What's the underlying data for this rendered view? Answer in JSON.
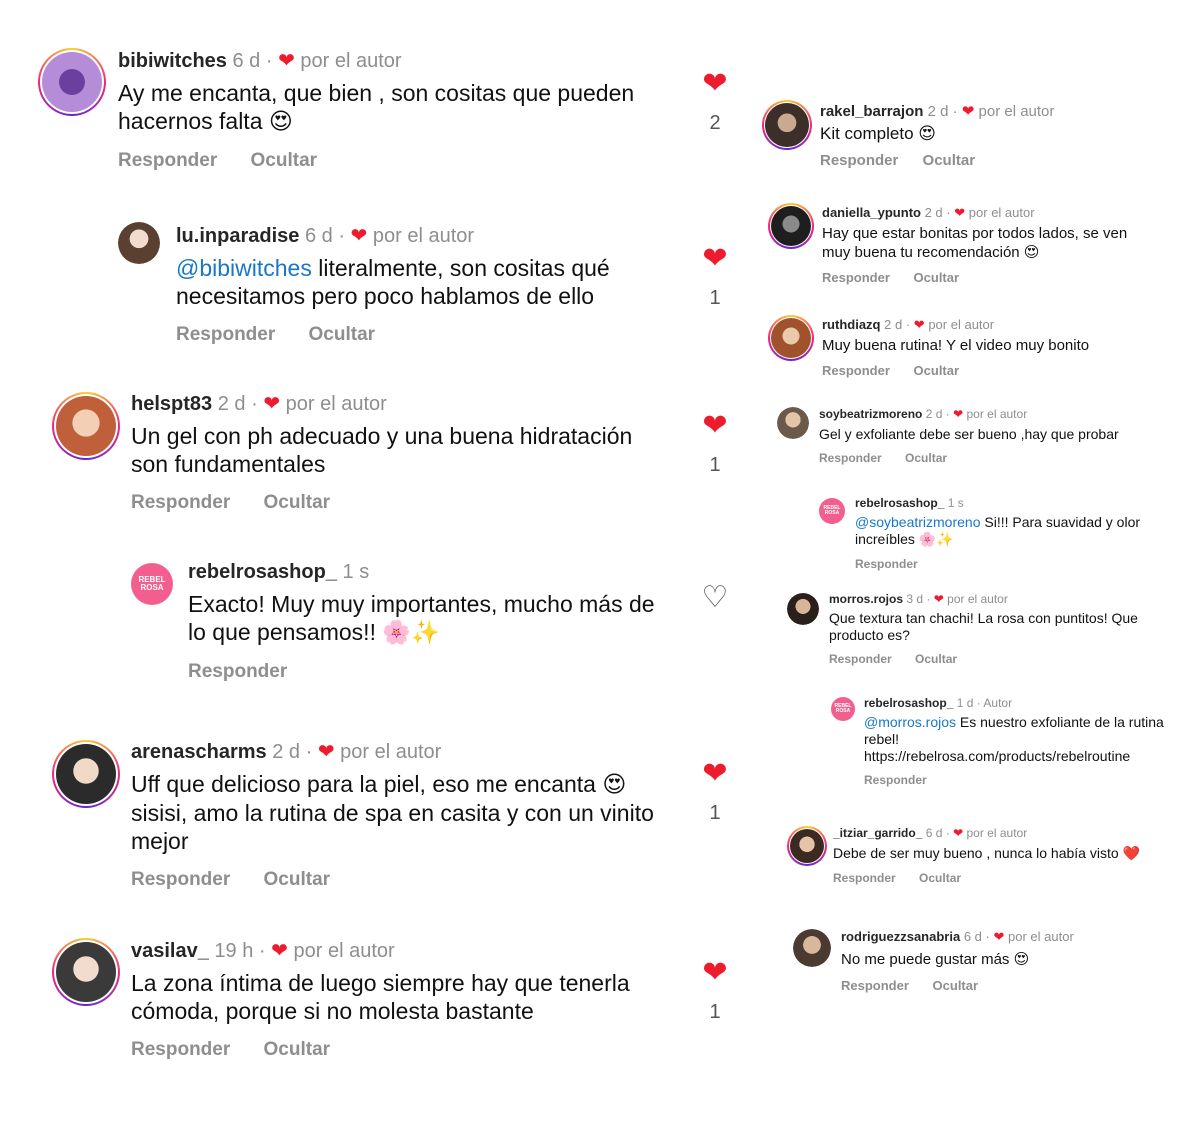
{
  "left_comments": [
    {
      "user": "bibiwitches",
      "time": "6 d",
      "by_author": "por el autor",
      "text": "Ay me encanta, que bien , son cositas que pueden hacernos falta",
      "emoji": "😍",
      "reply": "Responder",
      "hide": "Ocultar",
      "likes": "2"
    },
    {
      "user": "lu.inparadise",
      "time": "6 d",
      "by_author": "por el autor",
      "mention": "@bibiwitches",
      "text": " literalmente, son cositas qué necesitamos pero poco hablamos de ello",
      "reply": "Responder",
      "hide": "Ocultar",
      "likes": "1"
    },
    {
      "user": "helspt83",
      "time": "2 d",
      "by_author": "por el autor",
      "text": "Un gel con ph adecuado y una buena hidratación son fundamentales",
      "reply": "Responder",
      "hide": "Ocultar",
      "likes": "1"
    },
    {
      "user": "rebelrosashop_",
      "time": "1 s",
      "text": "Exacto! Muy muy importantes, mucho más de lo que pensamos!!",
      "emoji": "🌸✨",
      "reply": "Responder",
      "avatar_text": "REBEL ROSA"
    },
    {
      "user": "arenascharms",
      "time": "2 d",
      "by_author": "por el autor",
      "text": "Uff que delicioso para la piel, eso me encanta",
      "emoji": "😍",
      "text2": "sisisi, amo la rutina de spa en casita y con un vinito mejor",
      "reply": "Responder",
      "hide": "Ocultar",
      "likes": "1"
    },
    {
      "user": "vasilav_",
      "time": "19 h",
      "by_author": "por el autor",
      "text": "La zona íntima de luego siempre hay que tenerla cómoda, porque si no molesta bastante",
      "reply": "Responder",
      "hide": "Ocultar",
      "likes": "1"
    }
  ],
  "right_comments": [
    {
      "user": "rakel_barrajon",
      "time": "2 d",
      "by_author": "por el autor",
      "text": "Kit completo",
      "emoji": "😍",
      "reply": "Responder",
      "hide": "Ocultar"
    },
    {
      "user": "daniella_ypunto",
      "time": "2 d",
      "by_author": "por el autor",
      "text": "Hay que estar bonitas por todos lados, se ven muy buena tu recomendación",
      "emoji": "😍",
      "reply": "Responder",
      "hide": "Ocultar"
    },
    {
      "user": "ruthdiazq",
      "time": "2 d",
      "by_author": "por el autor",
      "text": "Muy buena rutina! Y el video muy bonito",
      "reply": "Responder",
      "hide": "Ocultar"
    },
    {
      "user": "soybeatrizmoreno",
      "time": "2 d",
      "by_author": "por el autor",
      "text": "Gel y exfoliante debe ser bueno ,hay que probar",
      "reply": "Responder",
      "hide": "Ocultar"
    },
    {
      "user": "rebelrosashop_",
      "time": "1 s",
      "mention": "@soybeatrizmoreno",
      "text": " Si!!! Para suavidad y olor increíbles",
      "emoji": "🌸✨",
      "reply": "Responder",
      "avatar_text": "REBEL ROSA"
    },
    {
      "user": "morros.rojos",
      "time": "3 d",
      "by_author": "por el autor",
      "text": "Que textura tan chachi! La rosa con puntitos! Que producto es?",
      "reply": "Responder",
      "hide": "Ocultar"
    },
    {
      "user": "rebelrosashop_",
      "time": "1 d",
      "by_author": "Autor",
      "mention": "@morros.rojos",
      "text": " Es nuestro exfoliante de la rutina rebel! https://rebelrosa.com/products/rebelroutine",
      "reply": "Responder",
      "avatar_text": "REBEL ROSA"
    },
    {
      "user": "_itziar_garrido_",
      "time": "6 d",
      "by_author": "por el autor",
      "text": "Debe de ser muy bueno , nunca lo había visto",
      "emoji": "❤️",
      "reply": "Responder",
      "hide": "Ocultar"
    },
    {
      "user": "rodriguezzsanabria",
      "time": "6 d",
      "by_author": "por el autor",
      "text": "No me puede gustar más",
      "emoji": "😍",
      "reply": "Responder",
      "hide": "Ocultar"
    }
  ],
  "sep": "·",
  "icons": {
    "heart_filled": "heart-icon",
    "heart_outline": "heart-outline-icon"
  },
  "colors": {
    "heart": "#ed1b2e",
    "mention": "#1877c9",
    "meta": "#8e8e8e",
    "rebel": "#f25f8e"
  }
}
